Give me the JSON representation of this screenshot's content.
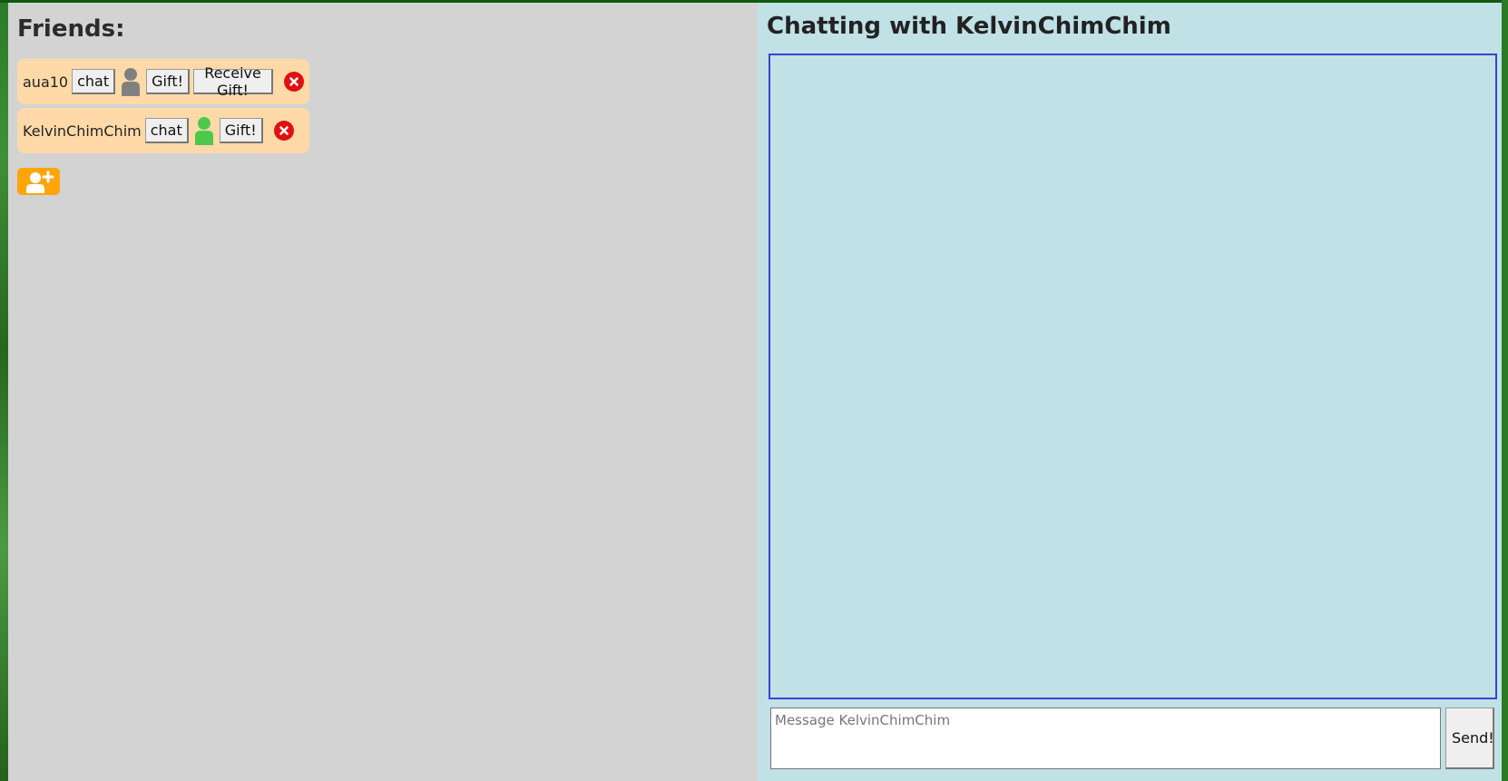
{
  "friends": {
    "title": "Friends:",
    "items": [
      {
        "name": "aua10",
        "chat_label": "chat",
        "status_icon": "person-icon",
        "status_color": "#808080",
        "gift_label": "Gift!",
        "receive_gift_label": "Receive Gift!"
      },
      {
        "name": "KelvinChimChim",
        "chat_label": "chat",
        "status_icon": "person-icon",
        "status_color": "#4cc94c",
        "gift_label": "Gift!"
      }
    ],
    "add_friend_icon": "add-person-icon"
  },
  "chat": {
    "title": "Chatting with KelvinChimChim",
    "message_placeholder": "Message KelvinChimChim",
    "send_label": "Send!"
  },
  "colors": {
    "friends_bg": "#d3d3d3",
    "friend_row_bg": "#ffdaa8",
    "chat_bg": "#c0e1e6",
    "chat_border": "#3f3fd6",
    "add_button": "#ffa50a",
    "remove": "#e01010"
  }
}
